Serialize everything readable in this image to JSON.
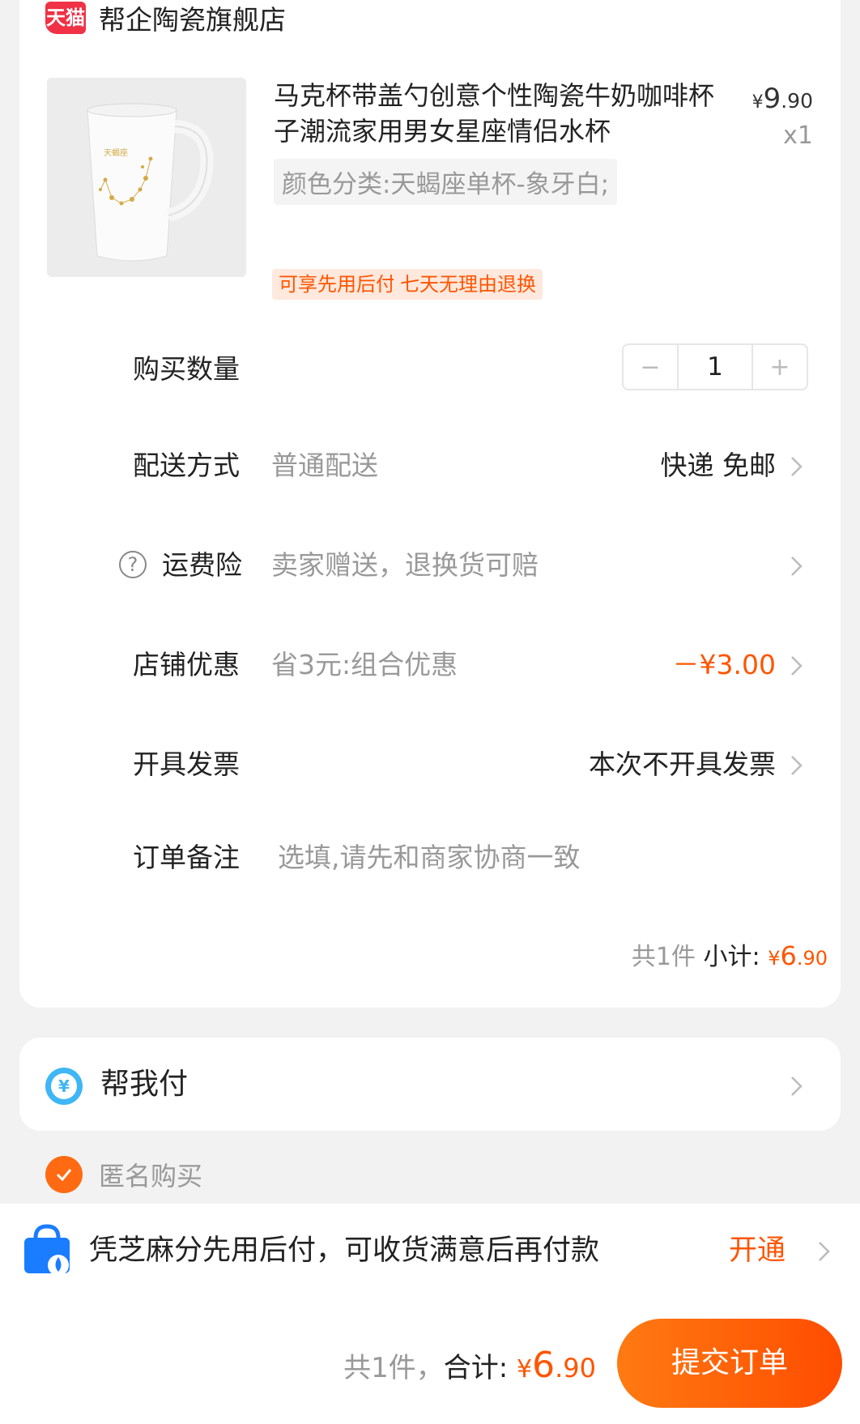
{
  "store": {
    "badge": "天猫",
    "name": "帮企陶瓷旗舰店"
  },
  "product": {
    "title": "马克杯带盖勺创意个性陶瓷牛奶咖啡杯子潮流家用男女星座情侣水杯",
    "price_symbol": "¥",
    "price_int": "9",
    "price_dec": ".90",
    "qty_label": "x1",
    "spec": "颜色分类:天蝎座单杯-象牙白;",
    "tags": [
      "可享先用后付",
      "七天无理由退换"
    ],
    "image_icon": "white-ceramic-mug-with-gold-scorpio-constellation"
  },
  "rows": {
    "quantity": {
      "label": "购买数量",
      "minus": "−",
      "value": "1",
      "plus": "+"
    },
    "delivery": {
      "label": "配送方式",
      "value": "普通配送",
      "right": "快递 免邮"
    },
    "insurance": {
      "label": "运费险",
      "value": "卖家赠送，退换货可赔",
      "help": "?"
    },
    "discount": {
      "label": "店铺优惠",
      "value": "省3元:组合优惠",
      "right": "－¥3.00"
    },
    "invoice": {
      "label": "开具发票",
      "right": "本次不开具发票"
    },
    "note": {
      "label": "订单备注",
      "placeholder": "选填,请先和商家协商一致"
    }
  },
  "subtotal": {
    "count": "共1件",
    "label": " 小计: ",
    "yen": "¥",
    "int": "6",
    "dec": ".90"
  },
  "help_pay": {
    "icon_char": "¥",
    "label": "帮我付"
  },
  "anonymous": {
    "label": "匿名购买",
    "checked": true
  },
  "promo": {
    "text": "凭芝麻分先用后付，可收货满意后再付款",
    "action": "开通"
  },
  "footer": {
    "count": "共1件，",
    "label": "合计: ",
    "yen": "¥",
    "int": "6",
    "dec": ".90",
    "submit": "提交订单"
  },
  "colors": {
    "accent": "#ff5500",
    "tmall_red": "#f03146",
    "pay_blue": "#3fb6f5"
  }
}
